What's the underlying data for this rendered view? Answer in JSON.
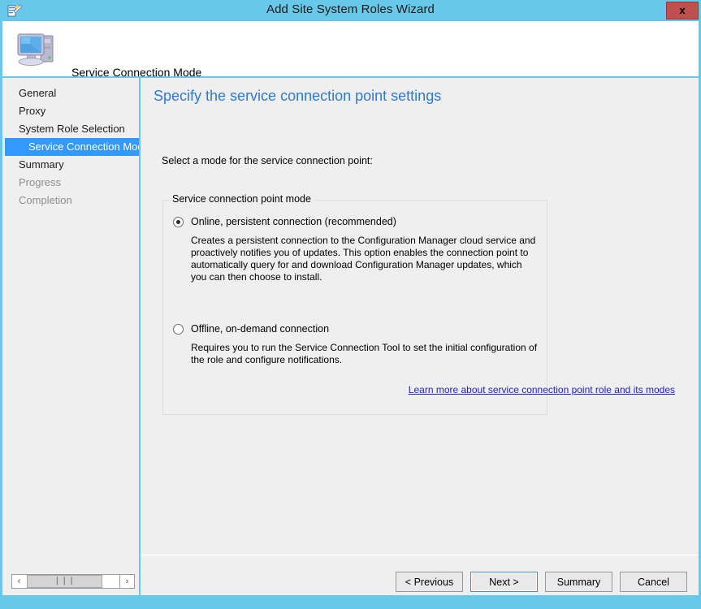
{
  "window": {
    "title": "Add Site System Roles Wizard",
    "icon": "wizard-icon",
    "close_label": "x",
    "accent_color": "#68c8ea"
  },
  "banner": {
    "icon": "computer-icon",
    "title": "Service Connection Mode"
  },
  "sidebar": {
    "items": [
      {
        "label": "General",
        "state": "normal",
        "level": 0
      },
      {
        "label": "Proxy",
        "state": "normal",
        "level": 0
      },
      {
        "label": "System Role Selection",
        "state": "normal",
        "level": 0
      },
      {
        "label": "Service Connection Mode",
        "state": "selected",
        "level": 1
      },
      {
        "label": "Summary",
        "state": "normal",
        "level": 0
      },
      {
        "label": "Progress",
        "state": "disabled",
        "level": 0
      },
      {
        "label": "Completion",
        "state": "disabled",
        "level": 0
      }
    ],
    "scrollbar": {
      "left_arrow": "‹",
      "right_arrow": "›",
      "thumb_grip": "❘❘❘"
    },
    "selected_color": "#3399ff"
  },
  "main": {
    "heading": "Specify the service connection point settings",
    "heading_color": "#2e7ad1",
    "prompt": "Select a mode for the service connection point:",
    "group": {
      "legend": "Service connection point mode",
      "options": [
        {
          "label": "Online, persistent connection (recommended)",
          "selected": true,
          "description": "Creates a persistent connection to the Configuration Manager cloud service and proactively notifies you of updates. This option enables the connection point to automatically query for and download Configuration Manager updates, which you can then choose to install."
        },
        {
          "label": "Offline, on-demand connection",
          "selected": false,
          "description": "Requires you to run the Service Connection Tool to set the initial configuration of the role and configure notifications."
        }
      ],
      "link": {
        "text": "Learn more about service connection point role and its modes",
        "color": "#2222cc"
      }
    }
  },
  "footer": {
    "buttons": [
      {
        "label": "< Previous",
        "focused": false
      },
      {
        "label": "Next >",
        "focused": true
      },
      {
        "label": "Summary",
        "focused": false
      },
      {
        "label": "Cancel",
        "focused": false
      }
    ]
  }
}
